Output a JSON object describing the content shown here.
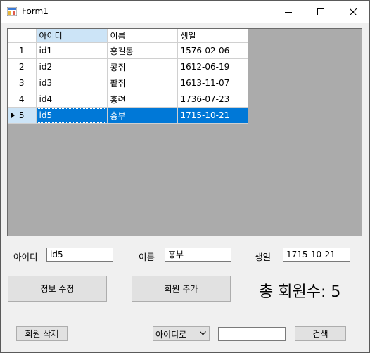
{
  "window": {
    "title": "Form1",
    "minimize_label": "minimize",
    "maximize_label": "maximize",
    "close_label": "close"
  },
  "grid": {
    "columns": [
      "아이디",
      "이름",
      "생일"
    ],
    "selected_column": 0,
    "rows": [
      {
        "num": "1",
        "id": "id1",
        "name": "홍길동",
        "birth": "1576-02-06"
      },
      {
        "num": "2",
        "id": "id2",
        "name": "콩쥐",
        "birth": "1612-06-19"
      },
      {
        "num": "3",
        "id": "id3",
        "name": "팥쥐",
        "birth": "1613-11-07"
      },
      {
        "num": "4",
        "id": "id4",
        "name": "홍련",
        "birth": "1736-07-23"
      },
      {
        "num": "5",
        "id": "id5",
        "name": "흥부",
        "birth": "1715-10-21"
      }
    ],
    "selected_row": 4
  },
  "form": {
    "id_label": "아이디",
    "id_value": "id5",
    "name_label": "이름",
    "name_value": "흥부",
    "birth_label": "생일",
    "birth_value": "1715-10-21"
  },
  "buttons": {
    "edit": "정보 수정",
    "add": "회원 추가",
    "delete": "회원 삭제",
    "search": "검색"
  },
  "total": "총 회원수: 5",
  "search": {
    "mode": "아이디로",
    "query": ""
  },
  "colors": {
    "selection": "#0078d7",
    "header_selected": "#cce4f7",
    "grid_background": "#ababab"
  }
}
